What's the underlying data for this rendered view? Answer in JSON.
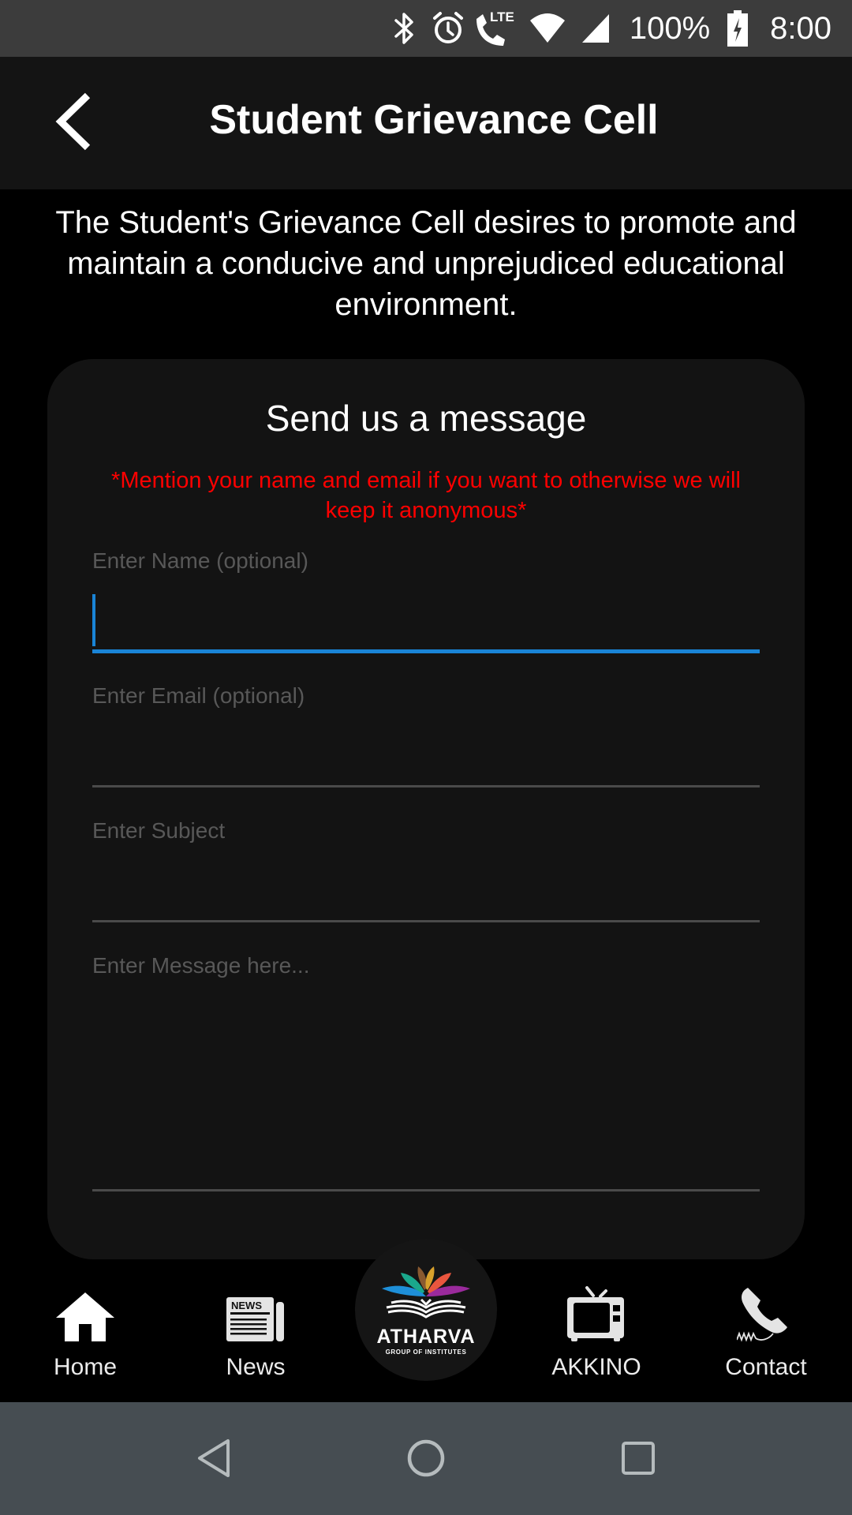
{
  "status_bar": {
    "icons": [
      "bluetooth-icon",
      "alarm-icon",
      "lte-call-icon",
      "wifi-icon",
      "cell-signal-icon",
      "battery-charging-icon"
    ],
    "lte_label": "LTE",
    "battery": "100%",
    "time": "8:00"
  },
  "app_bar": {
    "back_icon": "chevron-left-icon",
    "title": "Student Grievance Cell"
  },
  "intro": {
    "text": "The Student's Grievance Cell desires to promote and maintain a conducive and unprejudiced educational environment."
  },
  "form": {
    "title": "Send us a message",
    "note": "*Mention your name and email if you want to otherwise we will keep it anonymous*",
    "note_color": "#ff0000",
    "accent_color": "#1a84d6",
    "fields": [
      {
        "label": "Enter Name (optional)",
        "value": "",
        "focused": true
      },
      {
        "label": "Enter Email (optional)",
        "value": "",
        "focused": false
      },
      {
        "label": "Enter Subject",
        "value": "",
        "focused": false
      },
      {
        "label": "Enter Message here...",
        "value": "",
        "focused": false
      }
    ]
  },
  "bottom_nav": {
    "items": [
      {
        "label": "Home",
        "icon": "home-icon"
      },
      {
        "label": "News",
        "icon": "newspaper-icon"
      },
      {
        "label": "AKKINO",
        "icon": "tv-icon"
      },
      {
        "label": "Contact",
        "icon": "phone-icon"
      }
    ],
    "center_logo": {
      "name": "ATHARVA",
      "subtitle": "GROUP OF INSTITUTES",
      "news_badge": "NEWS"
    }
  },
  "system_nav": {
    "buttons": [
      "back",
      "home",
      "recents"
    ]
  }
}
